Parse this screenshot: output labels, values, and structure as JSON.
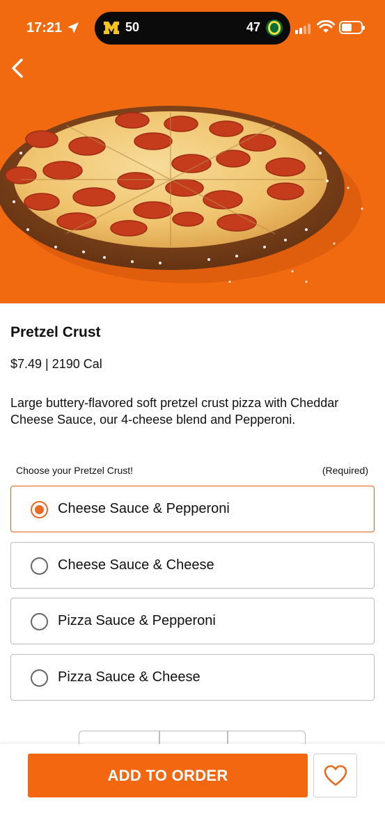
{
  "status_bar": {
    "time": "17:21",
    "score_left": "50",
    "score_right": "47"
  },
  "product": {
    "title": "Pretzel Crust",
    "price_cal": "$7.49 | 2190 Cal",
    "description": "Large buttery-flavored soft pretzel crust pizza with Cheddar Cheese Sauce, our 4-cheese blend and Pepperoni."
  },
  "choice": {
    "label": "Choose your Pretzel Crust!",
    "required": "(Required)",
    "options": [
      {
        "label": "Cheese Sauce & Pepperoni",
        "selected": true
      },
      {
        "label": "Cheese Sauce & Cheese",
        "selected": false
      },
      {
        "label": "Pizza Sauce & Pepperoni",
        "selected": false
      },
      {
        "label": "Pizza Sauce & Cheese",
        "selected": false
      }
    ]
  },
  "footer": {
    "add_label": "ADD TO ORDER"
  },
  "icons": {
    "back": "chevron-left-icon",
    "favorite": "heart-icon",
    "location": "location-arrow-icon",
    "wifi": "wifi-icon",
    "battery": "battery-icon",
    "signal": "cellular-signal-icon"
  },
  "colors": {
    "brand_orange": "#f26710",
    "hero_background": "#f26a10",
    "radio_selected": "#ea6a22"
  }
}
